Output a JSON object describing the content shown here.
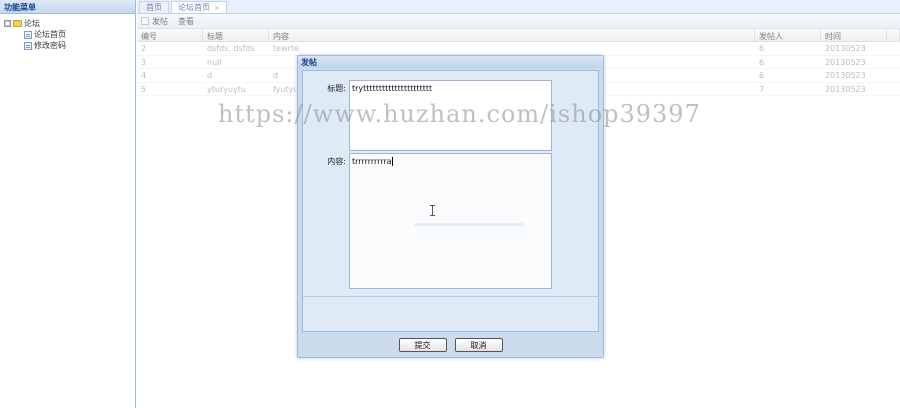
{
  "left_panel": {
    "title": "功能菜单",
    "tree": {
      "root_toggle": "□",
      "root_label": "论坛",
      "children": [
        {
          "label": "论坛首页"
        },
        {
          "label": "修改密码"
        }
      ]
    }
  },
  "tabs": [
    {
      "label": "首页"
    },
    {
      "label": "论坛首页",
      "close": "×"
    }
  ],
  "toolbar": {
    "post_label": "发帖",
    "view_label": "查看"
  },
  "grid": {
    "headers": [
      "编号",
      "标题",
      "内容",
      "发帖人",
      "时间"
    ],
    "rows": [
      [
        "2",
        "dsfds, dsfds",
        "tewrte",
        "6",
        "20130523"
      ],
      [
        "3",
        "null",
        "",
        "6",
        "20130523"
      ],
      [
        "4",
        "d",
        "d",
        "6",
        "20130523"
      ],
      [
        "5",
        "yturyuytu",
        "fyutyuy",
        "7",
        "20130523"
      ]
    ]
  },
  "dialog": {
    "title": "发帖",
    "title_label": "标题:",
    "title_value": "trytttttttttttttttttttttt",
    "content_label": "内容:",
    "content_value": "trrrrrrrrrra",
    "submit_label": "提交",
    "cancel_label": "取消"
  },
  "watermark": "https://www.huzhan.com/ishop39397"
}
